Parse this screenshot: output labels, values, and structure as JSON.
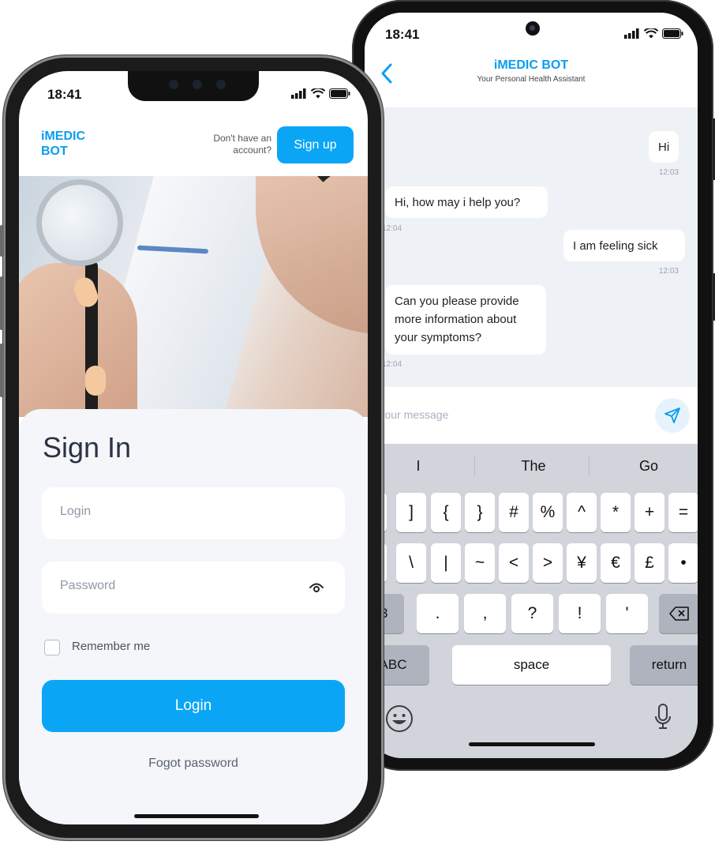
{
  "chat_screen": {
    "status_time": "18:41",
    "header": {
      "title": "iMEDIC BOT",
      "subtitle": "Your Personal Health Assistant"
    },
    "messages": [
      {
        "from": "user",
        "text": "Hi",
        "time": "12:03"
      },
      {
        "from": "bot",
        "text": "Hi, how may i help you?",
        "time": "12:04"
      },
      {
        "from": "user",
        "text": "I am feeling sick",
        "time": "12:03"
      },
      {
        "from": "bot",
        "text": "Can you please provide more information about your symptoms?",
        "time": "12:04"
      }
    ],
    "input": {
      "placeholder": "ype your message"
    },
    "keyboard": {
      "suggestions": [
        "I",
        "The",
        "Go"
      ],
      "row1": [
        "]",
        "{",
        "}",
        "#",
        "%",
        "^",
        "*",
        "+",
        "="
      ],
      "row2": [
        "\\",
        "|",
        "~",
        "<",
        ">",
        "¥",
        "€",
        "£",
        "•"
      ],
      "row3": [
        ".",
        ",",
        "?",
        "!",
        "'"
      ],
      "row3_left": "23",
      "abc": "ABC",
      "space": "space",
      "return": "return"
    }
  },
  "signin_screen": {
    "status_time": "18:41",
    "brand": "iMEDIC BOT",
    "no_account_text": "Don't have an account?",
    "signup_label": "Sign up",
    "title": "Sign In",
    "login_placeholder": "Login",
    "password_placeholder": "Password",
    "remember_label": "Remember me",
    "login_button": "Login",
    "forgot_label": "Fogot password"
  },
  "colors": {
    "accent": "#0aa6f5",
    "brand": "#0a9df0",
    "chat_bg": "#eef1f6"
  }
}
